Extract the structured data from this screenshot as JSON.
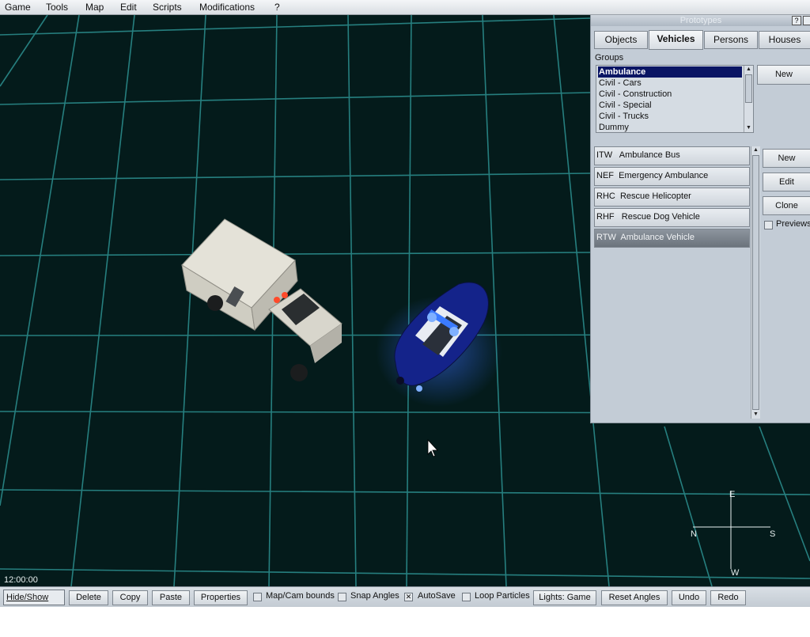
{
  "menu": [
    {
      "label": "Game",
      "accel": "G"
    },
    {
      "label": "Tools",
      "accel": "T"
    },
    {
      "label": "Map",
      "accel": "M"
    },
    {
      "label": "Edit",
      "accel": "E"
    },
    {
      "label": "Scripts",
      "accel": "S"
    },
    {
      "label": "Modifications",
      "accel": "o"
    },
    {
      "label": "?",
      "accel": "?"
    }
  ],
  "viewport": {
    "time": "12:00:00",
    "compass": {
      "north": "N",
      "south": "S",
      "east": "E",
      "west": "W"
    },
    "colors": {
      "background": "#041b1b",
      "grid": "#2a8a8a"
    }
  },
  "panel": {
    "title": "Prototypes",
    "help_label": "?",
    "tabs": [
      "Objects",
      "Vehicles",
      "Persons",
      "Houses"
    ],
    "active_tab": "Vehicles",
    "groups_label": "Groups",
    "groups": [
      "Ambulance",
      "Civil - Cars",
      "Civil - Construction",
      "Civil - Special",
      "Civil - Trucks",
      "Dummy"
    ],
    "selected_group": "Ambulance",
    "group_new_label": "New",
    "vehicles": [
      {
        "code": "ITW",
        "name": "Ambulance Bus"
      },
      {
        "code": "NEF",
        "name": "Emergency Ambulance"
      },
      {
        "code": "RHC",
        "name": "Rescue Helicopter"
      },
      {
        "code": "RHF",
        "name": "Rescue Dog Vehicle"
      },
      {
        "code": "RTW",
        "name": "Ambulance Vehicle"
      }
    ],
    "selected_vehicle": "RTW",
    "buttons": {
      "new": "New",
      "edit": "Edit",
      "clone": "Clone"
    },
    "previews_label": "Previews",
    "previews_checked": false
  },
  "toolbar": {
    "hide_show": "Hide/Show",
    "delete": "Delete",
    "copy": "Copy",
    "paste": "Paste",
    "properties": "Properties",
    "map_cam_bounds": "Map/Cam bounds",
    "map_cam_bounds_checked": false,
    "snap_angles": "Snap Angles",
    "snap_angles_checked": false,
    "autosave": "AutoSave",
    "autosave_checked": true,
    "loop_particles": "Loop Particles",
    "loop_particles_checked": false,
    "lights": "Lights: Game",
    "reset_angles": "Reset Angles",
    "undo": "Undo",
    "redo": "Redo"
  }
}
